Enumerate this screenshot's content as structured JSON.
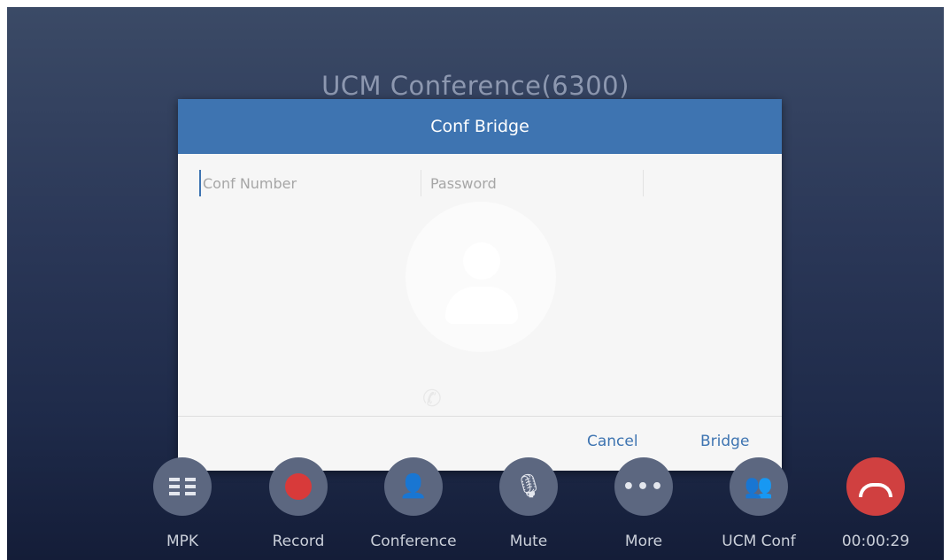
{
  "call": {
    "title": "UCM Conference(6300)"
  },
  "dialog": {
    "title": "Conf Bridge",
    "conf_number_placeholder": "Conf Number",
    "password_placeholder": "Password",
    "cancel_label": "Cancel",
    "bridge_label": "Bridge"
  },
  "controls": {
    "mpk_label": "MPK",
    "record_label": "Record",
    "conference_label": "Conference",
    "mute_label": "Mute",
    "more_label": "More",
    "ucm_conf_label": "UCM Conf",
    "timer": "00:00:29"
  },
  "colors": {
    "accent": "#3e74b1",
    "end_call": "#d04040",
    "record": "#d83a3a"
  },
  "icons": {
    "mpk": "grid-icon",
    "record": "record-dot-icon",
    "conference": "add-person-icon",
    "mute": "mute-mic-icon",
    "more": "more-dots-icon",
    "ucm_conf": "group-icon",
    "end_call": "hang-up-icon"
  }
}
